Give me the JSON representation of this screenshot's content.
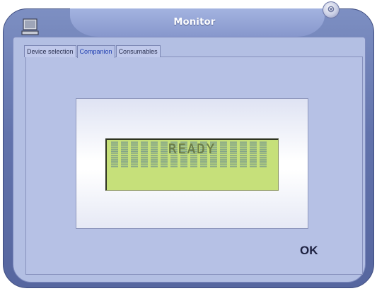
{
  "window": {
    "title": "Monitor",
    "close_glyph": "⊗"
  },
  "icons": {
    "app": "computer-icon",
    "close": "close-icon"
  },
  "tabs": [
    {
      "label": "Device selection",
      "active": false
    },
    {
      "label": "Companion",
      "active": true
    },
    {
      "label": "Consumables",
      "active": false
    }
  ],
  "lcd": {
    "text": "READY",
    "background_color": "#c6e07a"
  },
  "buttons": {
    "ok_label": "OK"
  },
  "colors": {
    "window_frame": "#6273ac",
    "client_bg": "#b3bfe3",
    "active_tab_text": "#2241b2"
  }
}
